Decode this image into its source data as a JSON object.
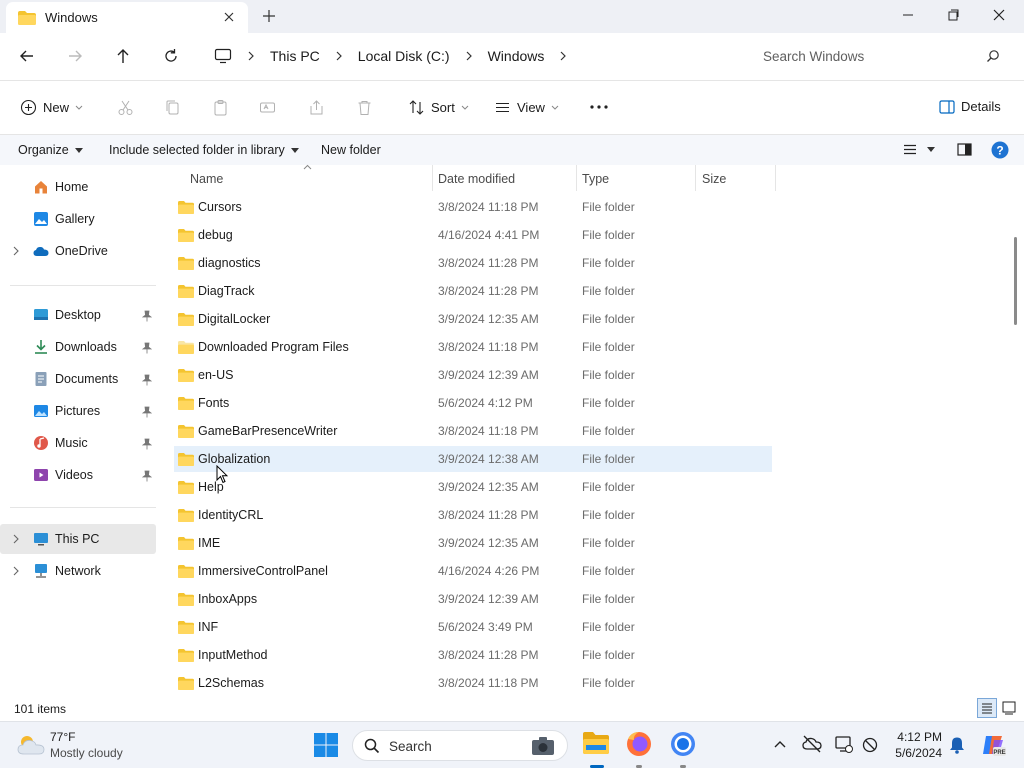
{
  "window": {
    "tab_title": "Windows",
    "accent": "#0067c0",
    "folder_color": "#f4c430"
  },
  "address": {
    "breadcrumbs": [
      "This PC",
      "Local Disk (C:)",
      "Windows"
    ],
    "search_placeholder": "Search Windows"
  },
  "commandbar": {
    "new_label": "New",
    "sort_label": "Sort",
    "view_label": "View",
    "details_label": "Details"
  },
  "organizebar": {
    "organize_label": "Organize",
    "include_label": "Include selected folder in library",
    "newfolder_label": "New folder"
  },
  "sidebar": {
    "items": [
      {
        "label": "Home",
        "icon": "home-icon"
      },
      {
        "label": "Gallery",
        "icon": "gallery-icon"
      },
      {
        "label": "OneDrive",
        "icon": "cloud-icon"
      },
      {
        "label": "Desktop",
        "icon": "desktop-icon"
      },
      {
        "label": "Downloads",
        "icon": "download-icon"
      },
      {
        "label": "Documents",
        "icon": "document-icon"
      },
      {
        "label": "Pictures",
        "icon": "pictures-icon"
      },
      {
        "label": "Music",
        "icon": "music-icon"
      },
      {
        "label": "Videos",
        "icon": "videos-icon"
      },
      {
        "label": "This PC",
        "icon": "monitor-icon"
      },
      {
        "label": "Network",
        "icon": "network-icon"
      }
    ]
  },
  "filelist": {
    "headers": {
      "name": "Name",
      "date": "Date modified",
      "type": "Type",
      "size": "Size"
    },
    "rows": [
      {
        "name": "Cursors",
        "date": "3/8/2024 11:18 PM",
        "type": "File folder"
      },
      {
        "name": "debug",
        "date": "4/16/2024 4:41 PM",
        "type": "File folder"
      },
      {
        "name": "diagnostics",
        "date": "3/8/2024 11:28 PM",
        "type": "File folder"
      },
      {
        "name": "DiagTrack",
        "date": "3/8/2024 11:28 PM",
        "type": "File folder"
      },
      {
        "name": "DigitalLocker",
        "date": "3/9/2024 12:35 AM",
        "type": "File folder"
      },
      {
        "name": "Downloaded Program Files",
        "date": "3/8/2024 11:18 PM",
        "type": "File folder"
      },
      {
        "name": "en-US",
        "date": "3/9/2024 12:39 AM",
        "type": "File folder"
      },
      {
        "name": "Fonts",
        "date": "5/6/2024 4:12 PM",
        "type": "File folder"
      },
      {
        "name": "GameBarPresenceWriter",
        "date": "3/8/2024 11:18 PM",
        "type": "File folder"
      },
      {
        "name": "Globalization",
        "date": "3/9/2024 12:38 AM",
        "type": "File folder"
      },
      {
        "name": "Help",
        "date": "3/9/2024 12:35 AM",
        "type": "File folder"
      },
      {
        "name": "IdentityCRL",
        "date": "3/8/2024 11:28 PM",
        "type": "File folder"
      },
      {
        "name": "IME",
        "date": "3/9/2024 12:35 AM",
        "type": "File folder"
      },
      {
        "name": "ImmersiveControlPanel",
        "date": "4/16/2024 4:26 PM",
        "type": "File folder"
      },
      {
        "name": "InboxApps",
        "date": "3/9/2024 12:39 AM",
        "type": "File folder"
      },
      {
        "name": "INF",
        "date": "5/6/2024 3:49 PM",
        "type": "File folder"
      },
      {
        "name": "InputMethod",
        "date": "3/8/2024 11:28 PM",
        "type": "File folder"
      },
      {
        "name": "L2Schemas",
        "date": "3/8/2024 11:18 PM",
        "type": "File folder"
      }
    ]
  },
  "status": {
    "item_count": "101 items"
  },
  "taskbar": {
    "weather_temp": "77°F",
    "weather_cond": "Mostly cloudy",
    "search_placeholder": "Search",
    "time": "4:12 PM",
    "date": "5/6/2024"
  }
}
